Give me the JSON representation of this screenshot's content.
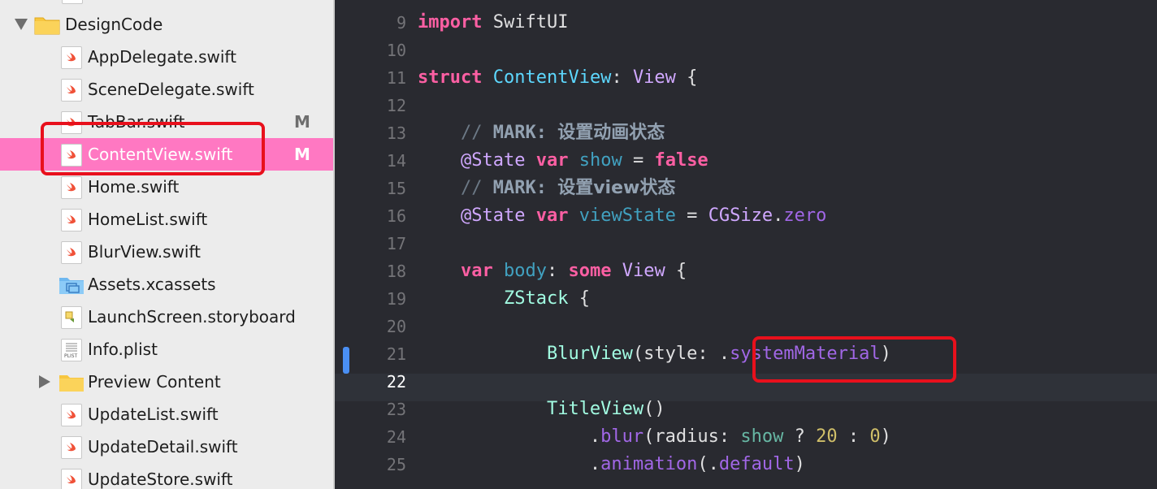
{
  "navigator": {
    "group": {
      "name": "DesignCode",
      "expanded": true
    },
    "items": [
      {
        "label": "AppDelegate.swift",
        "kind": "swift",
        "badge": ""
      },
      {
        "label": "SceneDelegate.swift",
        "kind": "swift",
        "badge": ""
      },
      {
        "label": "TabBar.swift",
        "kind": "swift",
        "badge": "M"
      },
      {
        "label": "ContentView.swift",
        "kind": "swift",
        "badge": "M",
        "selected": true
      },
      {
        "label": "Home.swift",
        "kind": "swift",
        "badge": ""
      },
      {
        "label": "HomeList.swift",
        "kind": "swift",
        "badge": ""
      },
      {
        "label": "BlurView.swift",
        "kind": "swift",
        "badge": ""
      },
      {
        "label": "Assets.xcassets",
        "kind": "assets",
        "badge": ""
      },
      {
        "label": "LaunchScreen.storyboard",
        "kind": "storyboard",
        "badge": ""
      },
      {
        "label": "Info.plist",
        "kind": "plist",
        "badge": ""
      },
      {
        "label": "Preview Content",
        "kind": "folder",
        "badge": ""
      },
      {
        "label": "UpdateList.swift",
        "kind": "swift",
        "badge": ""
      },
      {
        "label": "UpdateDetail.swift",
        "kind": "swift",
        "badge": ""
      },
      {
        "label": "UpdateStore.swift",
        "kind": "swift",
        "badge": ""
      }
    ],
    "plist_icon_text": "PLIST"
  },
  "editor": {
    "current_line": 22,
    "lines": [
      {
        "n": "9",
        "tokens": [
          [
            "kw",
            "import"
          ],
          [
            "plain",
            " SwiftUI"
          ]
        ]
      },
      {
        "n": "10",
        "tokens": []
      },
      {
        "n": "11",
        "tokens": [
          [
            "kw",
            "struct"
          ],
          [
            "plain",
            " "
          ],
          [
            "type",
            "ContentView"
          ],
          [
            "plain",
            ": "
          ],
          [
            "tref",
            "View"
          ],
          [
            "plain",
            " {"
          ]
        ]
      },
      {
        "n": "12",
        "tokens": []
      },
      {
        "n": "13",
        "tokens": [
          [
            "plain",
            "    "
          ],
          [
            "cmt",
            "// "
          ],
          [
            "mark",
            "MARK:"
          ],
          [
            "cmt",
            " "
          ],
          [
            "cjk",
            "设置动画状态"
          ]
        ]
      },
      {
        "n": "14",
        "tokens": [
          [
            "plain",
            "    "
          ],
          [
            "attr",
            "@State"
          ],
          [
            "plain",
            " "
          ],
          [
            "kw",
            "var"
          ],
          [
            "plain",
            " "
          ],
          [
            "prop",
            "show"
          ],
          [
            "plain",
            " = "
          ],
          [
            "boolv",
            "false"
          ]
        ]
      },
      {
        "n": "15",
        "tokens": [
          [
            "plain",
            "    "
          ],
          [
            "cmt",
            "// "
          ],
          [
            "mark",
            "MARK:"
          ],
          [
            "cmt",
            " "
          ],
          [
            "cjk",
            "设置view状态"
          ]
        ]
      },
      {
        "n": "16",
        "tokens": [
          [
            "plain",
            "    "
          ],
          [
            "attr",
            "@State"
          ],
          [
            "plain",
            " "
          ],
          [
            "kw",
            "var"
          ],
          [
            "plain",
            " "
          ],
          [
            "prop",
            "viewState"
          ],
          [
            "plain",
            " = "
          ],
          [
            "tref",
            "CGSize"
          ],
          [
            "plain",
            "."
          ],
          [
            "member",
            "zero"
          ]
        ]
      },
      {
        "n": "17",
        "tokens": []
      },
      {
        "n": "18",
        "tokens": [
          [
            "plain",
            "    "
          ],
          [
            "kw",
            "var"
          ],
          [
            "plain",
            " "
          ],
          [
            "prop",
            "body"
          ],
          [
            "plain",
            ": "
          ],
          [
            "kw",
            "some"
          ],
          [
            "plain",
            " "
          ],
          [
            "tref",
            "View"
          ],
          [
            "plain",
            " {"
          ]
        ]
      },
      {
        "n": "19",
        "tokens": [
          [
            "plain",
            "        "
          ],
          [
            "otype",
            "ZStack"
          ],
          [
            "plain",
            " {"
          ]
        ]
      },
      {
        "n": "20",
        "tokens": []
      },
      {
        "n": "21",
        "tokens": [
          [
            "plain",
            "            "
          ],
          [
            "otype",
            "BlurView"
          ],
          [
            "plain",
            "(style: "
          ],
          [
            "plain",
            "."
          ],
          [
            "member",
            "systemMaterial"
          ],
          [
            "plain",
            ")"
          ]
        ]
      },
      {
        "n": "22",
        "tokens": []
      },
      {
        "n": "23",
        "tokens": [
          [
            "plain",
            "            "
          ],
          [
            "otype",
            "TitleView"
          ],
          [
            "plain",
            "()"
          ]
        ]
      },
      {
        "n": "24",
        "tokens": [
          [
            "plain",
            "                ."
          ],
          [
            "member",
            "blur"
          ],
          [
            "plain",
            "(radius: "
          ],
          [
            "func",
            "show"
          ],
          [
            "plain",
            " ? "
          ],
          [
            "num",
            "20"
          ],
          [
            "plain",
            " : "
          ],
          [
            "num",
            "0"
          ],
          [
            "plain",
            ")"
          ]
        ]
      },
      {
        "n": "25",
        "tokens": [
          [
            "plain",
            "                ."
          ],
          [
            "member",
            "animation"
          ],
          [
            "plain",
            "(."
          ],
          [
            "member",
            "default"
          ],
          [
            "plain",
            ")"
          ]
        ]
      }
    ]
  },
  "colors": {
    "selection": "#ff78c2",
    "annotation": "#e8101c",
    "editor_bg": "#292a30",
    "sidebar_bg": "#ececec"
  }
}
